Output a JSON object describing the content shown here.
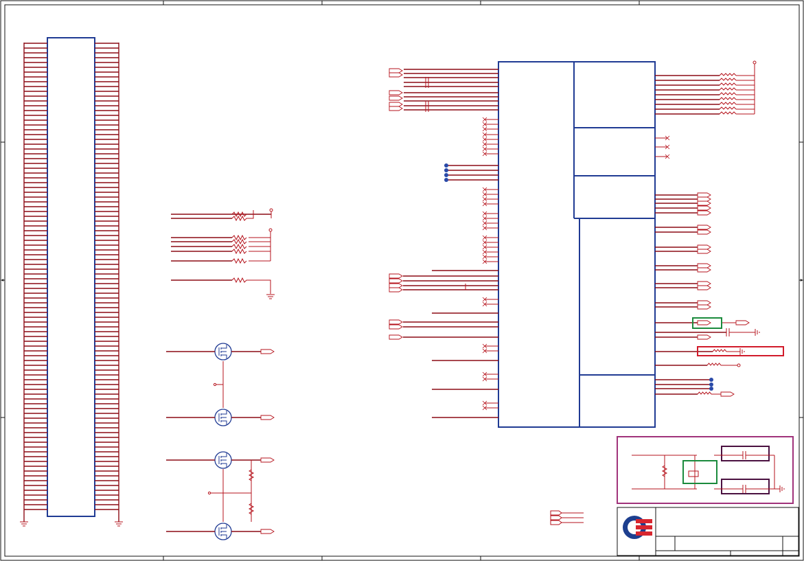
{
  "sheet": {
    "title_block_text": ""
  },
  "colors": {
    "wire": "#b5121b",
    "wire_dark": "#8b0a14",
    "component_block": "#1f3a93",
    "frame": "#111111",
    "highlight_green": "#1a8a3c",
    "highlight_red": "#d11a2a",
    "highlight_purple": "#a0327a",
    "logo_blue": "#1d3f8f",
    "logo_red": "#d8262f"
  },
  "icons": {
    "logo": "company-logo-icon",
    "mosfet": "mosfet-icon",
    "resistor": "resistor-icon",
    "capacitor": "capacitor-icon",
    "ground": "ground-icon",
    "crystal": "crystal-icon"
  }
}
